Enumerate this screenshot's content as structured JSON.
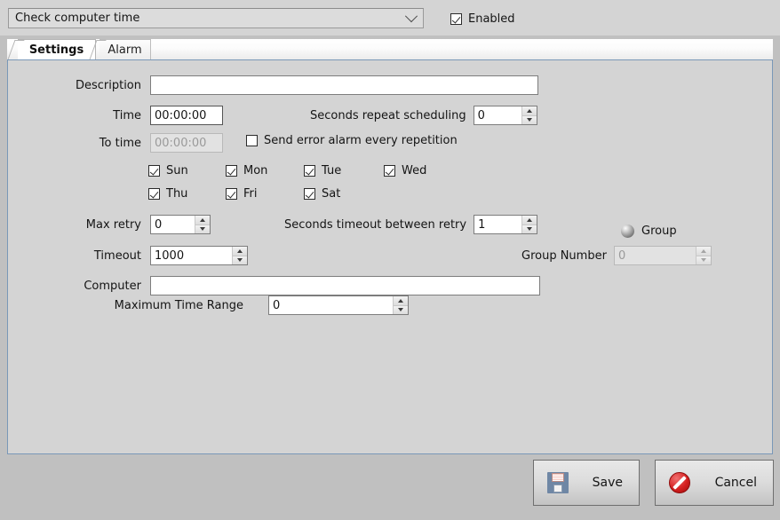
{
  "window": {
    "task_selector": {
      "value": "Check computer time",
      "icon": "chevron-down-icon"
    },
    "enabled": {
      "label": "Enabled",
      "checked": true
    }
  },
  "tabs": [
    {
      "label": "Settings",
      "active": true
    },
    {
      "label": "Alarm",
      "active": false
    }
  ],
  "form": {
    "description": {
      "label": "Description",
      "value": "",
      "placeholder": ""
    },
    "time": {
      "label": "Time",
      "value": "00:00:00",
      "enabled": true
    },
    "to_time": {
      "label": "To time",
      "value": "00:00:00",
      "enabled": false
    },
    "seconds_repeat_scheduling": {
      "label": "Seconds repeat scheduling",
      "value": "0"
    },
    "send_error_alarm": {
      "label": "Send error alarm every repetition",
      "checked": false
    },
    "days": [
      {
        "label": "Sun",
        "checked": true
      },
      {
        "label": "Mon",
        "checked": true
      },
      {
        "label": "Tue",
        "checked": true
      },
      {
        "label": "Wed",
        "checked": true
      },
      {
        "label": "Thu",
        "checked": true
      },
      {
        "label": "Fri",
        "checked": true
      },
      {
        "label": "Sat",
        "checked": true
      }
    ],
    "max_retry": {
      "label": "Max retry",
      "value": "0"
    },
    "seconds_timeout_between_retry": {
      "label": "Seconds timeout between retry",
      "value": "1"
    },
    "timeout": {
      "label": "Timeout",
      "value": "1000"
    },
    "group": {
      "label": "Group",
      "icon": "sphere-icon"
    },
    "group_number": {
      "label": "Group Number",
      "value": "0",
      "enabled": false
    },
    "computer": {
      "label": "Computer",
      "value": ""
    },
    "maximum_time_range": {
      "label": "Maximum Time Range",
      "value": "0"
    }
  },
  "footer": {
    "save": {
      "label": "Save",
      "icon": "floppy-disk-icon"
    },
    "cancel": {
      "label": "Cancel",
      "icon": "no-entry-icon"
    }
  }
}
